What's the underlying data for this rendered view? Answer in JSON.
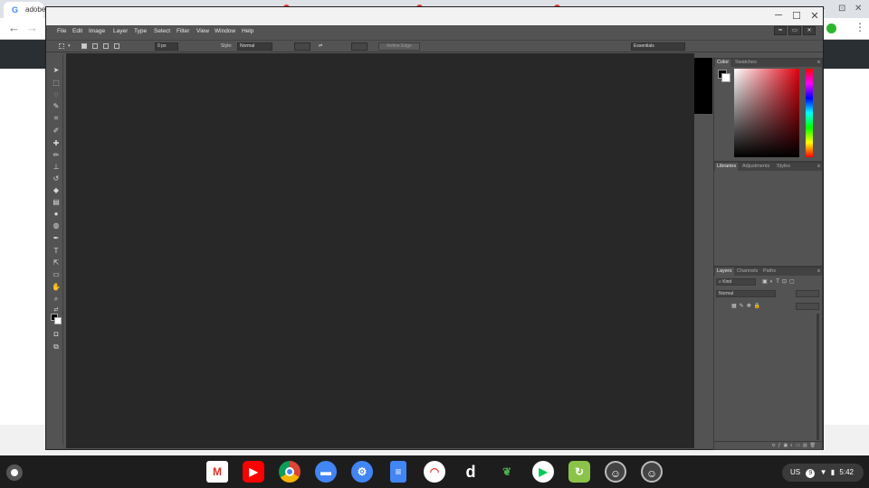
{
  "browser": {
    "tab_title": "adobe",
    "tab_favicon": "google-g-icon",
    "controls": [
      "-",
      "⊡",
      "✕"
    ]
  },
  "window": {
    "controls": {
      "minimize": "─",
      "maximize": "☐",
      "close": "✕"
    }
  },
  "menu": [
    "File",
    "Edit",
    "Image",
    "Layer",
    "Type",
    "Select",
    "Filter",
    "View",
    "Window",
    "Help"
  ],
  "doc_controls": [
    "━",
    "▭",
    "✕"
  ],
  "options_bar": {
    "feather_value": "0 px",
    "style_label": "Style:",
    "style_value": "Normal",
    "refine_edge": "Refine Edge",
    "workspace": "Essentials"
  },
  "panels": {
    "color": {
      "tabs": [
        "Color",
        "Swatches"
      ]
    },
    "libraries": {
      "tabs": [
        "Libraries",
        "Adjustments",
        "Styles"
      ]
    },
    "layers": {
      "tabs": [
        "Layers",
        "Channels",
        "Paths"
      ],
      "filter_kind": "Kind",
      "blend_mode": "Normal"
    }
  },
  "shelf": {
    "apps": [
      "Gmail",
      "YouTube",
      "Chrome",
      "Files",
      "Settings",
      "Docs",
      "Rainbow",
      "Dictionary",
      "Snapseed",
      "Play Store",
      "Converter",
      "Linux",
      "Linux"
    ],
    "status": {
      "ime": "US",
      "badge": "9",
      "time": "5:42"
    }
  },
  "colors": {
    "ps_panel": "#535353",
    "ps_canvas": "#282828",
    "shelf": "#1d1d1d"
  }
}
